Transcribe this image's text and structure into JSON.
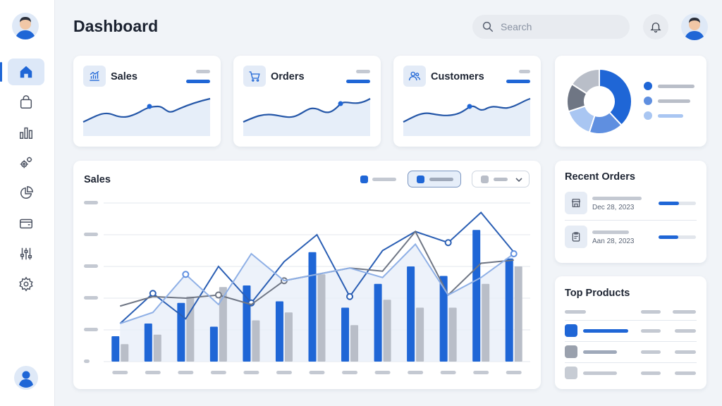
{
  "page": {
    "title": "Dashboard"
  },
  "search": {
    "placeholder": "Search"
  },
  "stats": [
    {
      "label": "Sales",
      "icon": "chart-icon"
    },
    {
      "label": "Orders",
      "icon": "cart-icon"
    },
    {
      "label": "Customers",
      "icon": "users-icon"
    }
  ],
  "sidebar": {
    "items": [
      {
        "name": "home",
        "icon": "home-icon",
        "active": true
      },
      {
        "name": "bag",
        "icon": "bag-icon"
      },
      {
        "name": "analytics",
        "icon": "bar-chart-icon"
      },
      {
        "name": "integrations",
        "icon": "gears-icon"
      },
      {
        "name": "reports",
        "icon": "pie-icon"
      },
      {
        "name": "wallet",
        "icon": "wallet-icon"
      },
      {
        "name": "filters",
        "icon": "sliders-icon"
      },
      {
        "name": "settings",
        "icon": "gear-icon"
      }
    ]
  },
  "main_chart": {
    "title": "Sales"
  },
  "recent_orders": {
    "title": "Recent Orders",
    "items": [
      {
        "date": "Dec 28, 2023",
        "icon": "store-icon",
        "progress": 0.55
      },
      {
        "date": "Aan 28, 2023",
        "icon": "clipboard-icon",
        "progress": 0.52
      }
    ]
  },
  "top_products": {
    "title": "Top Products"
  },
  "colors": {
    "primary": "#1f66d6",
    "primary_light": "#5f8fe0",
    "primary_pale": "#a9c6f2",
    "gray": "#b9bec8",
    "dark_gray": "#6f7684",
    "background": "#f1f4f8"
  },
  "chart_data": [
    {
      "type": "pie",
      "slices": [
        {
          "value": 38,
          "color": "#1f66d6"
        },
        {
          "value": 17,
          "color": "#5f8fe0"
        },
        {
          "value": 15,
          "color": "#a9c6f2"
        },
        {
          "value": 14,
          "color": "#6f7684"
        },
        {
          "value": 16,
          "color": "#b9bec8"
        }
      ],
      "legend": "right"
    },
    {
      "type": "bar",
      "grid": true,
      "ylim": [
        0,
        100
      ],
      "series": [
        {
          "values": [
            16,
            24,
            37,
            22,
            48,
            38,
            69,
            34,
            49,
            60,
            54,
            83,
            65
          ]
        },
        {
          "values": [
            11,
            17,
            41,
            47,
            26,
            31,
            55,
            23,
            39,
            34,
            34,
            49,
            60
          ]
        }
      ],
      "lines": [
        {
          "values": [
            24,
            43,
            27,
            60,
            37,
            63,
            80,
            41,
            70,
            82,
            75,
            94,
            69
          ]
        },
        {
          "values": [
            35,
            41,
            40,
            42,
            36,
            51,
            55,
            59,
            57,
            82,
            42,
            62,
            64
          ]
        },
        {
          "values": [
            24,
            31,
            55,
            36,
            68,
            51,
            55,
            59,
            53,
            74,
            42,
            53,
            68
          ]
        }
      ]
    }
  ]
}
